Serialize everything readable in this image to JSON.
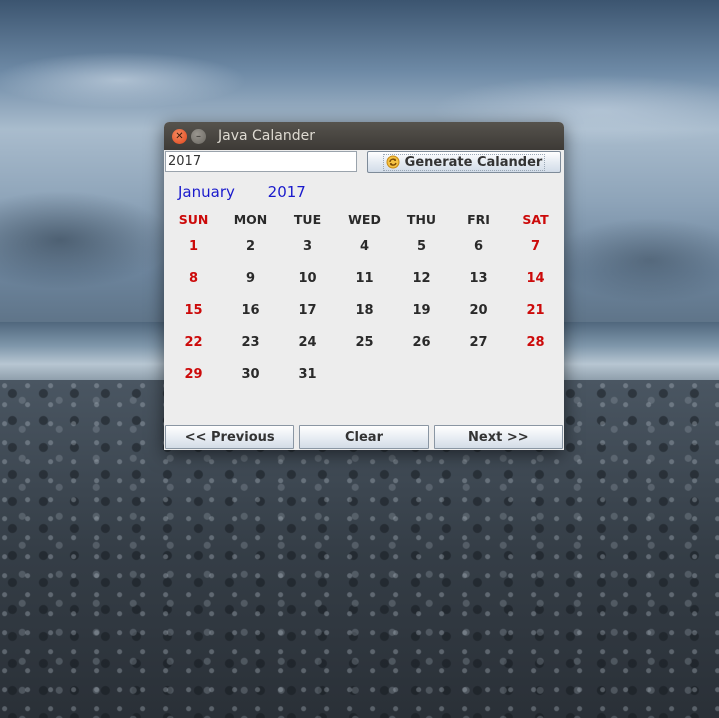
{
  "window": {
    "title": "Java Calander"
  },
  "toolbar": {
    "year_value": "2017",
    "generate_label": "Generate Calander"
  },
  "calendar": {
    "month": "January",
    "year": "2017",
    "weekdays": [
      "SUN",
      "MON",
      "TUE",
      "WED",
      "THU",
      "FRI",
      "SAT"
    ],
    "weeks": [
      [
        "1",
        "2",
        "3",
        "4",
        "5",
        "6",
        "7"
      ],
      [
        "8",
        "9",
        "10",
        "11",
        "12",
        "13",
        "14"
      ],
      [
        "15",
        "16",
        "17",
        "18",
        "19",
        "20",
        "21"
      ],
      [
        "22",
        "23",
        "24",
        "25",
        "26",
        "27",
        "28"
      ],
      [
        "29",
        "30",
        "31",
        "",
        "",
        "",
        ""
      ]
    ]
  },
  "nav": {
    "previous_label": "<< Previous",
    "clear_label": "Clear",
    "next_label": "Next >>"
  },
  "colors": {
    "weekend": "#cc0a0a",
    "month_title": "#1a1acc",
    "weekday_text": "#2a2a2a"
  }
}
